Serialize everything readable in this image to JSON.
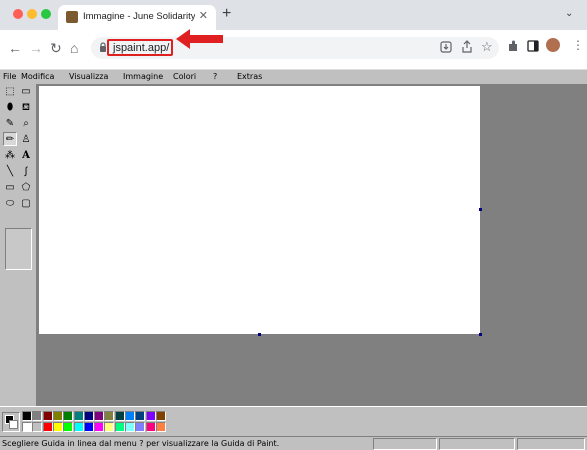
{
  "browser": {
    "tab_title": "Immagine - June Solidarity Paint",
    "tab_close": "✕",
    "new_tab": "+",
    "url": "jspaint.app/",
    "back": "←",
    "forward": "→",
    "reload": "↻",
    "home": "⌂",
    "tab_menu": "⌄"
  },
  "menubar": [
    "File",
    "Modifica",
    "Visualizza",
    "Immagine",
    "Colori",
    "?",
    "Extras"
  ],
  "tools": [
    {
      "name": "free-select-tool",
      "glyph": "⬚"
    },
    {
      "name": "select-tool",
      "glyph": "▭"
    },
    {
      "name": "eraser-tool",
      "glyph": "⬮"
    },
    {
      "name": "fill-tool",
      "glyph": "⛾"
    },
    {
      "name": "color-picker-tool",
      "glyph": "✎"
    },
    {
      "name": "magnifier-tool",
      "glyph": "⌕"
    },
    {
      "name": "pencil-tool",
      "glyph": "✏"
    },
    {
      "name": "brush-tool",
      "glyph": "♙"
    },
    {
      "name": "airbrush-tool",
      "glyph": "⁂"
    },
    {
      "name": "text-tool",
      "glyph": "A"
    },
    {
      "name": "line-tool",
      "glyph": "╲"
    },
    {
      "name": "curve-tool",
      "glyph": "∫"
    },
    {
      "name": "rectangle-tool",
      "glyph": "▭"
    },
    {
      "name": "polygon-tool",
      "glyph": "⬠"
    },
    {
      "name": "ellipse-tool",
      "glyph": "⬭"
    },
    {
      "name": "rounded-rectangle-tool",
      "glyph": "▢"
    }
  ],
  "palette_top": [
    "#000000",
    "#808080",
    "#800000",
    "#808000",
    "#008000",
    "#008080",
    "#000080",
    "#800080",
    "#808040",
    "#004040",
    "#0080ff",
    "#004080",
    "#8000ff",
    "#804000"
  ],
  "palette_bottom": [
    "#ffffff",
    "#c0c0c0",
    "#ff0000",
    "#ffff00",
    "#00ff00",
    "#00ffff",
    "#0000ff",
    "#ff00ff",
    "#ffff80",
    "#00ff80",
    "#80ffff",
    "#8080ff",
    "#ff0080",
    "#ff8040"
  ],
  "status": {
    "text": "Scegliere Guida in linea dal menu ? per visualizzare la Guida di Paint."
  },
  "colors": {
    "annotation_red": "#e02020",
    "canvas": "#ffffff",
    "workspace": "#808080",
    "chrome_gray": "#c0c0c0"
  }
}
